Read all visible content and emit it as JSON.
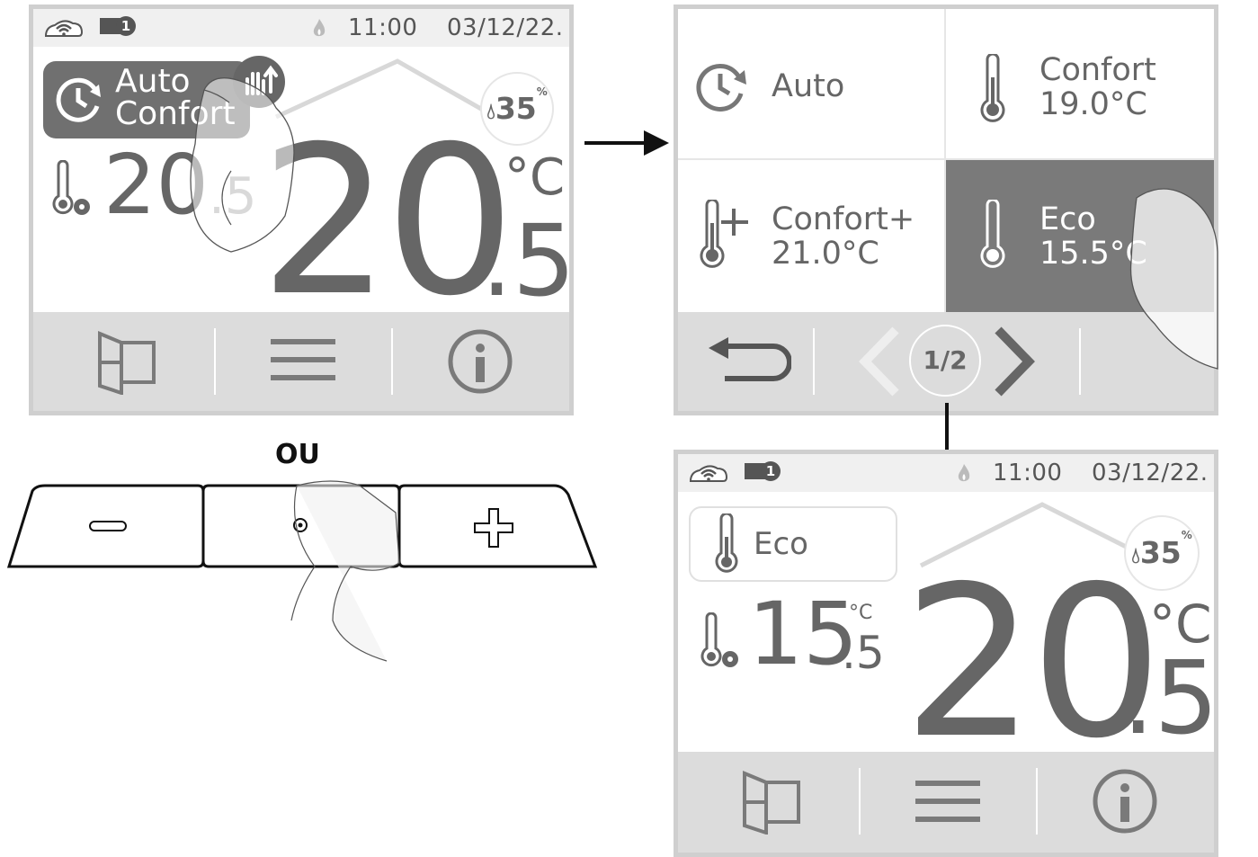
{
  "screen_main": {
    "status": {
      "time": "11:00",
      "date": "03/12/22.",
      "badge": "1",
      "icons": [
        "wifi-icon",
        "card-icon",
        "flame-icon"
      ]
    },
    "mode": {
      "line1": "Auto",
      "line2": "Confort"
    },
    "humidity": {
      "value": "35",
      "unit": "%"
    },
    "setpoint": {
      "int": "20",
      "dec": ".5"
    },
    "temperature": {
      "int": "20",
      "dec": ".5",
      "unit": "°C"
    },
    "bottom_icons": [
      "window-icon",
      "menu-icon",
      "info-icon"
    ]
  },
  "screen_modes": {
    "tiles": [
      {
        "label": "Auto",
        "value": ""
      },
      {
        "label": "Confort",
        "value": "19.0°C"
      },
      {
        "label": "Confort+",
        "value": "21.0°C"
      },
      {
        "label": "Eco",
        "value": "15.5°C",
        "selected": true
      }
    ],
    "pager": "1/2",
    "bottom_icons": [
      "back-icon",
      "prev-icon",
      "next-icon"
    ]
  },
  "ou_label": "OU",
  "buttons": {
    "minus": "minus-icon",
    "center": "center-icon",
    "plus": "plus-icon"
  },
  "screen_eco": {
    "status": {
      "time": "11:00",
      "date": "03/12/22.",
      "badge": "1"
    },
    "mode": {
      "label": "Eco"
    },
    "humidity": {
      "value": "35",
      "unit": "%"
    },
    "setpoint": {
      "int": "15",
      "dec": ".5",
      "unit": "°C"
    },
    "temperature": {
      "int": "20",
      "dec": ".5",
      "unit": "°C"
    },
    "bottom_icons": [
      "window-icon",
      "menu-icon",
      "info-icon"
    ]
  },
  "colors": {
    "dark": "#707070",
    "selected_tile": "#7a7a7a",
    "bar": "#dcdcdc",
    "frame": "#cfcfcf",
    "roof": "#d8d8d8"
  }
}
